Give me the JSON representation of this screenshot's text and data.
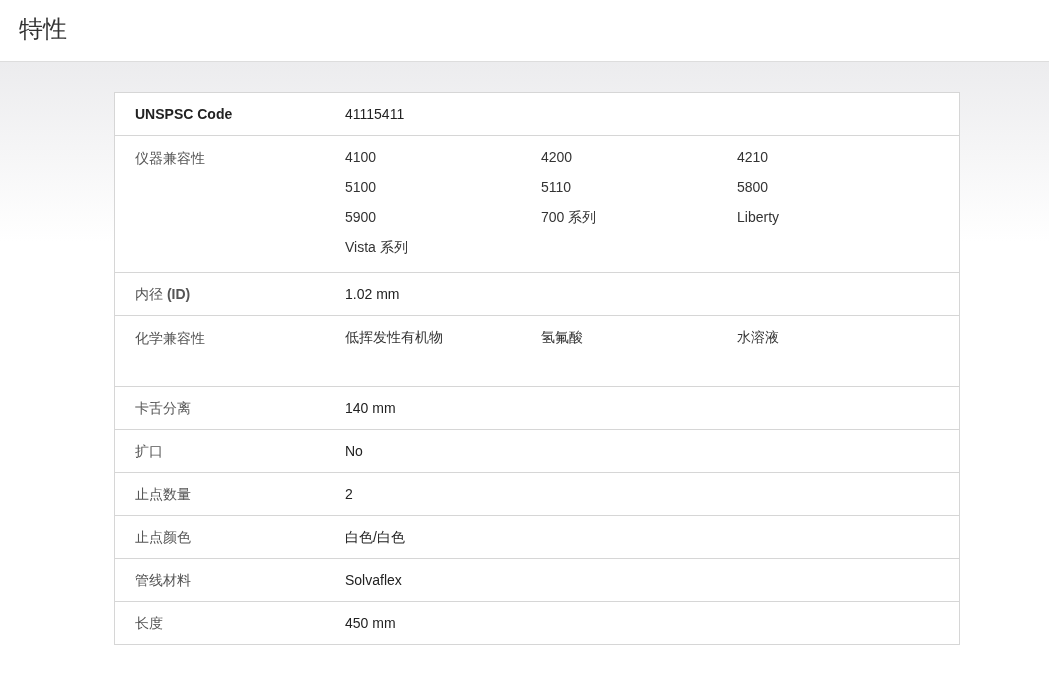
{
  "header": {
    "title": "特性"
  },
  "rows": [
    {
      "label": "UNSPSC Code",
      "emphasis": true,
      "kind": "single",
      "value": "41115411"
    },
    {
      "label": "仪器兼容性",
      "emphasis": false,
      "kind": "grid",
      "values": [
        "4100",
        "4200",
        "4210",
        "5100",
        "5110",
        "5800",
        "5900",
        "700 系列",
        "Liberty",
        "Vista 系列"
      ]
    },
    {
      "label": "内径 **(ID)**",
      "emphasis": false,
      "kind": "single",
      "value": "1.02 mm"
    },
    {
      "label": "化学兼容性",
      "emphasis": false,
      "kind": "grid",
      "values": [
        "低挥发性有机物",
        "氢氟酸",
        "水溶液"
      ]
    },
    {
      "label": "卡舌分离",
      "emphasis": false,
      "kind": "single",
      "value": "140 mm"
    },
    {
      "label": "扩口",
      "emphasis": false,
      "kind": "single",
      "value": "No"
    },
    {
      "label": "止点数量",
      "emphasis": false,
      "kind": "single",
      "value": "2"
    },
    {
      "label": "止点颜色",
      "emphasis": false,
      "kind": "single",
      "value": "白色/白色"
    },
    {
      "label": "管线材料",
      "emphasis": false,
      "kind": "single",
      "value": "Solvaflex"
    },
    {
      "label": "长度",
      "emphasis": false,
      "kind": "single",
      "value": "450 mm"
    }
  ]
}
